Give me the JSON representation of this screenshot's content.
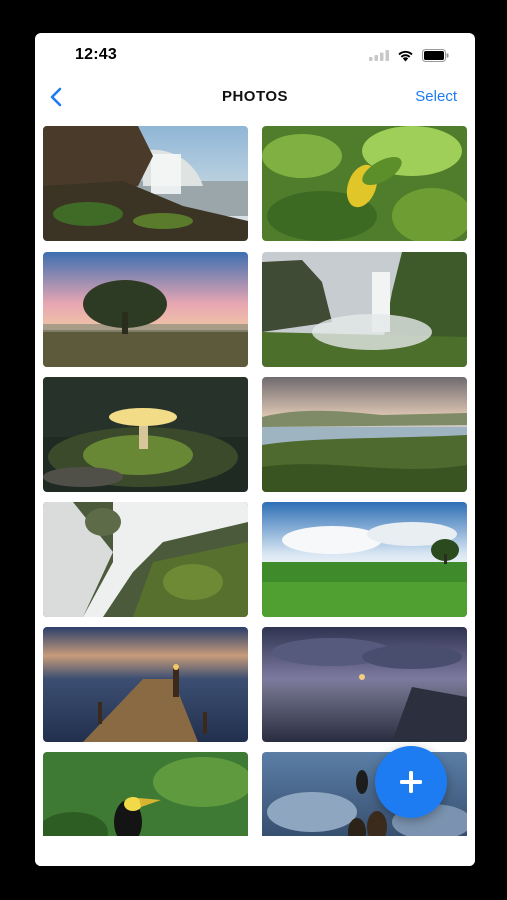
{
  "status_bar": {
    "time": "12:43"
  },
  "nav": {
    "title": "PHOTOS",
    "select_label": "Select"
  },
  "photos": [
    {
      "name": "waterfall-cliff"
    },
    {
      "name": "green-leaves"
    },
    {
      "name": "lone-tree-sunset"
    },
    {
      "name": "skogafoss-waterfall"
    },
    {
      "name": "glowing-mushroom"
    },
    {
      "name": "coastal-hills"
    },
    {
      "name": "cascade-rocks"
    },
    {
      "name": "green-field-tree"
    },
    {
      "name": "pier-dusk"
    },
    {
      "name": "reflective-lake"
    },
    {
      "name": "toucan"
    },
    {
      "name": "birds-night"
    }
  ],
  "fab": {
    "icon": "plus-icon"
  },
  "colors": {
    "accent": "#1e7cf2",
    "background": "#ffffff",
    "frame": "#000000"
  }
}
